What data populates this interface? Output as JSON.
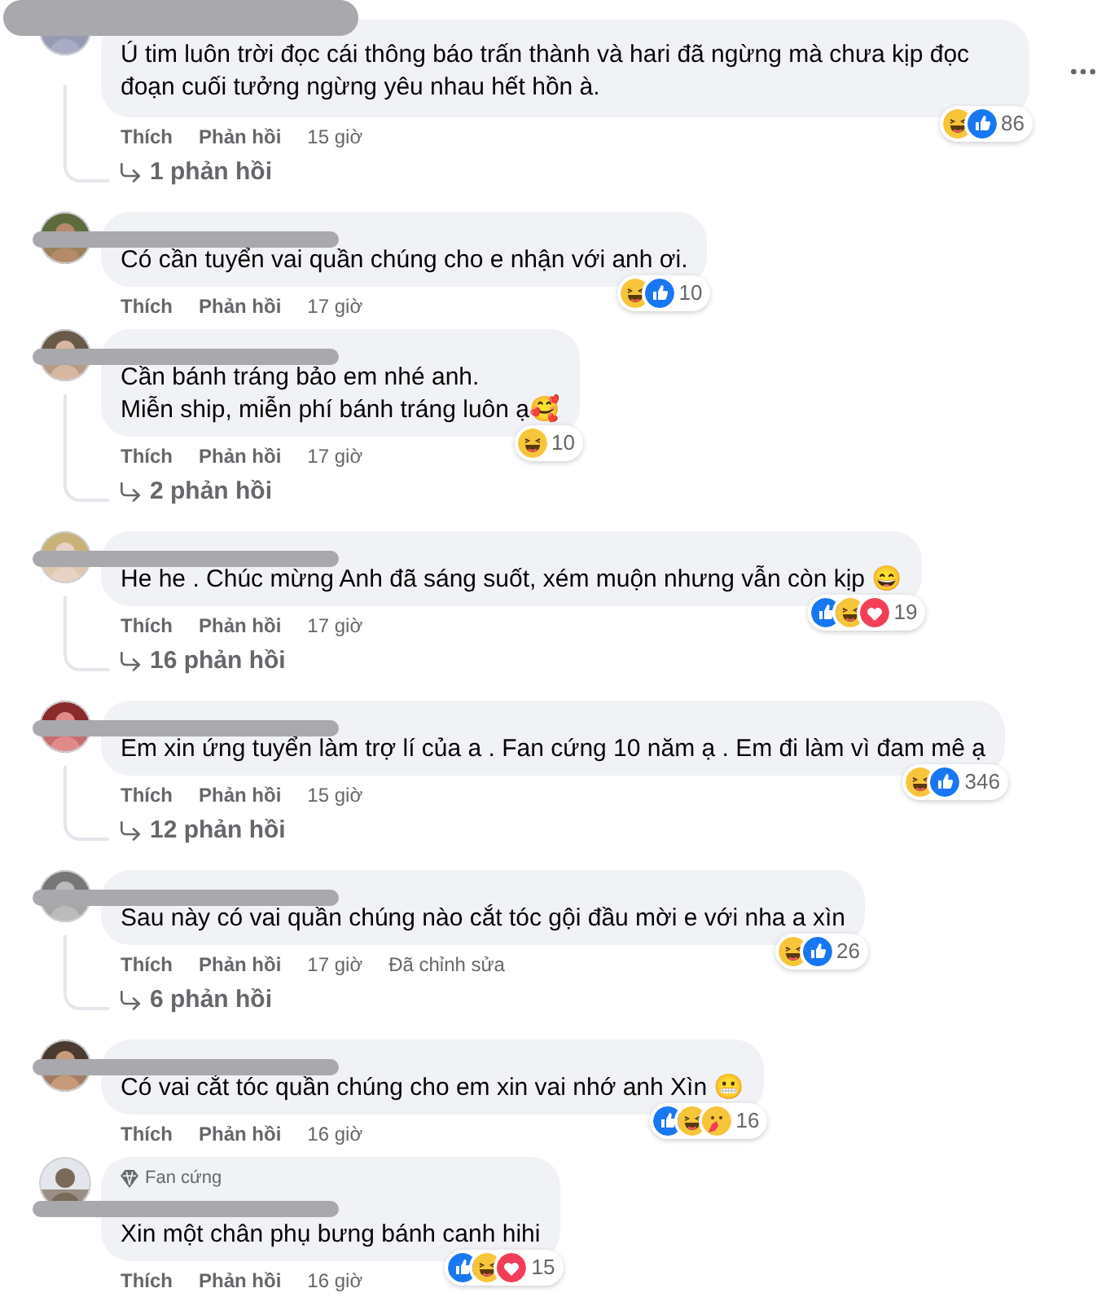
{
  "comments": [
    {
      "kind": "continued",
      "text": "Ú tim luôn trời đọc cái thông báo trấn thành và hari đã ngừng mà chưa kịp đọc đoạn cuối tưởng ngừng yêu nhau hết hồn à.",
      "actions": [
        "Thích",
        "Phản hồi"
      ],
      "time": "15 giờ",
      "reactions": [
        {
          "kind": "haha"
        },
        {
          "kind": "like"
        }
      ],
      "reaction_count": "86",
      "replies": "1 phản hồi",
      "menu": true
    },
    {
      "kind": "full",
      "text": "Có cần tuyển vai quần chúng cho e nhận với anh ơi.",
      "actions": [
        "Thích",
        "Phản hồi"
      ],
      "time": "17 giờ",
      "reactions": [
        {
          "kind": "haha"
        },
        {
          "kind": "like"
        }
      ],
      "reaction_count": "10"
    },
    {
      "kind": "full",
      "text": "Cần bánh tráng bảo em nhé anh.\nMiễn ship, miễn phí bánh tráng luôn ạ🥰",
      "actions": [
        "Thích",
        "Phản hồi"
      ],
      "time": "17 giờ",
      "reactions": [
        {
          "kind": "haha"
        }
      ],
      "reaction_count": "10",
      "replies": "2 phản hồi"
    },
    {
      "kind": "full",
      "text": "He he . Chúc mừng Anh đã sáng suốt, xém muộn nhưng vẫn còn kịp 😄",
      "actions": [
        "Thích",
        "Phản hồi"
      ],
      "time": "17 giờ",
      "reactions": [
        {
          "kind": "like"
        },
        {
          "kind": "haha"
        },
        {
          "kind": "love"
        }
      ],
      "reaction_count": "19",
      "replies": "16 phản hồi"
    },
    {
      "kind": "full",
      "text": "Em xin ứng tuyển làm trợ lí của a . Fan cứng 10 năm ạ . Em đi làm vì đam mê ạ",
      "actions": [
        "Thích",
        "Phản hồi"
      ],
      "time": "15 giờ",
      "reactions": [
        {
          "kind": "haha"
        },
        {
          "kind": "like"
        }
      ],
      "reaction_count": "346",
      "replies": "12 phản hồi"
    },
    {
      "kind": "full",
      "text": "Sau này có vai quần chúng nào cắt tóc gội đầu mời e với nha a xìn",
      "actions": [
        "Thích",
        "Phản hồi"
      ],
      "time": "17 giờ",
      "edited": "Đã chỉnh sửa",
      "reactions": [
        {
          "kind": "haha"
        },
        {
          "kind": "like"
        }
      ],
      "reaction_count": "26",
      "replies": "6 phản hồi"
    },
    {
      "kind": "full",
      "text": "Có vai cắt tóc quần chúng cho em xin vai nhớ anh Xìn 😬",
      "actions": [
        "Thích",
        "Phản hồi"
      ],
      "time": "16 giờ",
      "reactions": [
        {
          "kind": "like"
        },
        {
          "kind": "haha"
        },
        {
          "kind": "care"
        }
      ],
      "reaction_count": "16"
    },
    {
      "kind": "full",
      "badge": "Fan cứng",
      "text": "Xin một chân phụ bưng bánh canh hihi",
      "actions": [
        "Thích",
        "Phản hồi"
      ],
      "time": "16 giờ",
      "reactions": [
        {
          "kind": "like"
        },
        {
          "kind": "haha"
        },
        {
          "kind": "love"
        }
      ],
      "reaction_count": "15"
    }
  ]
}
